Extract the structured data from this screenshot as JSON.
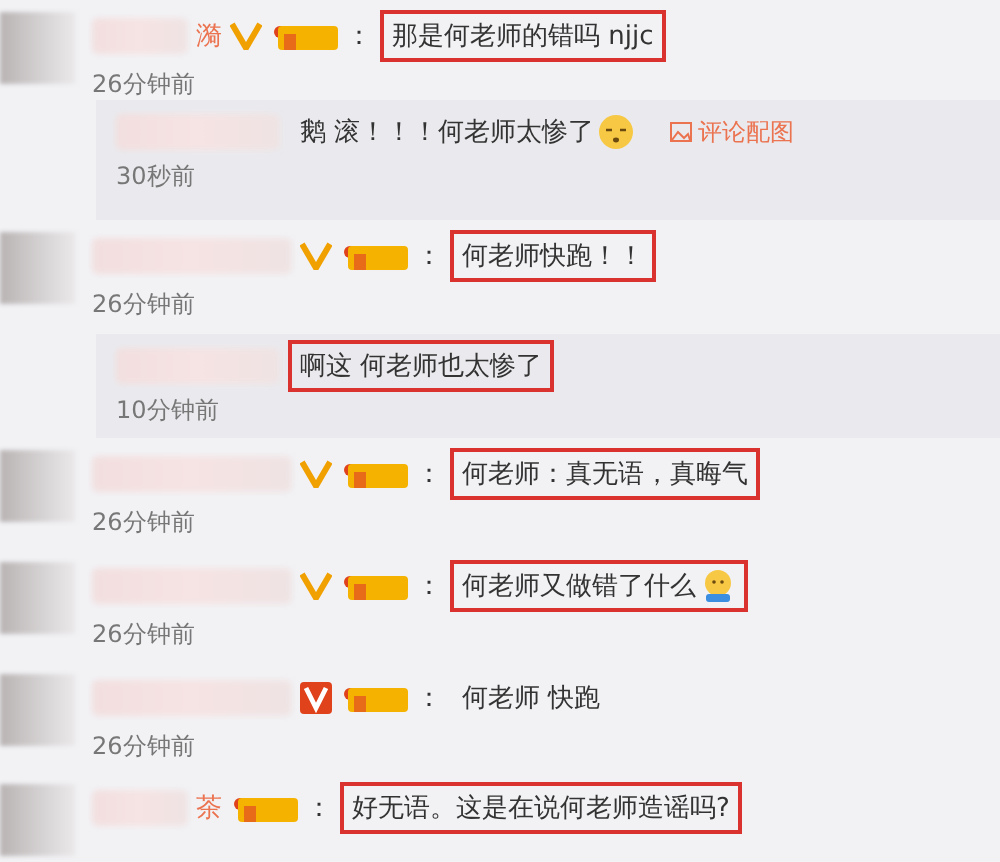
{
  "comments": [
    {
      "kind": "comment",
      "name_tail": "漪",
      "verified": true,
      "fan_badge": true,
      "colon": "：",
      "text": "那是何老师的错吗 njjc",
      "highlighted": true,
      "time": "26分钟前"
    },
    {
      "kind": "reply",
      "text": "鹅 滚！！！何老师太惨了",
      "emoji": true,
      "link": "评论配图",
      "highlighted": false,
      "time": "30秒前"
    },
    {
      "kind": "comment",
      "verified": true,
      "fan_badge": true,
      "colon": "：",
      "text": "何老师快跑！！",
      "highlighted": true,
      "time": "26分钟前"
    },
    {
      "kind": "reply",
      "text": "啊这 何老师也太惨了",
      "highlighted": true,
      "time": "10分钟前"
    },
    {
      "kind": "comment",
      "verified": true,
      "fan_badge": true,
      "colon": "：",
      "text": "何老师：真无语，真晦气",
      "highlighted": true,
      "time": "26分钟前"
    },
    {
      "kind": "comment",
      "verified": true,
      "fan_badge": true,
      "colon": "：",
      "text": "何老师又做错了什么",
      "emoji": true,
      "highlighted": true,
      "time": "26分钟前"
    },
    {
      "kind": "comment",
      "verified": true,
      "verified_boxed": true,
      "fan_badge": true,
      "colon": "：",
      "text": "何老师 快跑",
      "highlighted": false,
      "time": "26分钟前"
    },
    {
      "kind": "comment",
      "name_tail": "茶",
      "verified": false,
      "fan_badge": true,
      "colon": "：",
      "text": "好无语。这是在说何老师造谣吗?",
      "highlighted": true
    }
  ]
}
